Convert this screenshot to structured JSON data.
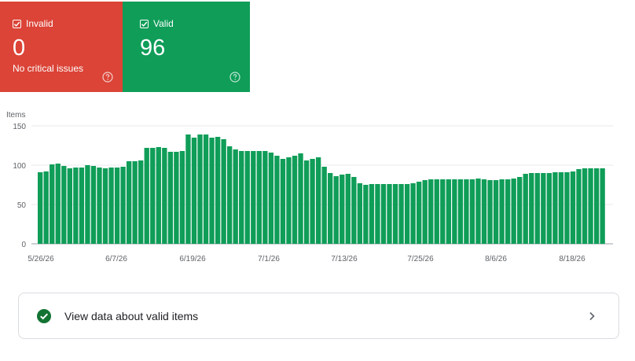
{
  "cards": {
    "invalid": {
      "label": "Invalid",
      "count": "0",
      "subtitle": "No critical issues",
      "color": "#db4437"
    },
    "valid": {
      "label": "Valid",
      "count": "96",
      "color": "#0f9d58"
    }
  },
  "chart_data": {
    "type": "bar",
    "ylabel": "Items",
    "ylim": [
      0,
      150
    ],
    "yticks": [
      0,
      50,
      100,
      150
    ],
    "xtick_labels": [
      "5/26/26",
      "6/7/26",
      "6/19/26",
      "7/1/26",
      "7/13/26",
      "7/25/26",
      "8/6/26",
      "8/18/26"
    ],
    "grid": true,
    "bar_color": "#0f9d58",
    "values": [
      91,
      92,
      101,
      102,
      99,
      96,
      97,
      97,
      100,
      99,
      97,
      96,
      97,
      97,
      98,
      105,
      105,
      106,
      122,
      122,
      123,
      122,
      117,
      117,
      118,
      139,
      135,
      139,
      139,
      135,
      136,
      133,
      124,
      120,
      118,
      118,
      118,
      118,
      118,
      116,
      112,
      108,
      110,
      112,
      115,
      106,
      108,
      110,
      98,
      90,
      86,
      88,
      89,
      85,
      77,
      75,
      76,
      76,
      76,
      76,
      76,
      76,
      76,
      77,
      79,
      81,
      82,
      82,
      82,
      82,
      82,
      82,
      82,
      82,
      83,
      82,
      81,
      81,
      82,
      82,
      83,
      85,
      89,
      90,
      90,
      90,
      90,
      91,
      91,
      91,
      92,
      95,
      96,
      96,
      96,
      96
    ]
  },
  "details_link": {
    "label": "View data about valid items"
  },
  "icons": {
    "checkbox": "checkbox-checked-icon",
    "help": "help-circle-icon",
    "check": "check-circle-icon",
    "chevron": "chevron-right-icon"
  }
}
